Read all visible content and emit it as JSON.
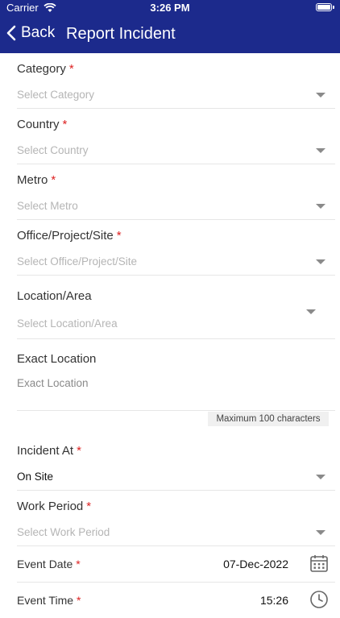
{
  "status": {
    "carrier": "Carrier",
    "time": "3:26 PM"
  },
  "nav": {
    "back_label": "Back",
    "title": "Report Incident"
  },
  "required_marker": "*",
  "fields": {
    "category": {
      "label": "Category",
      "placeholder": "Select Category"
    },
    "country": {
      "label": "Country",
      "placeholder": "Select Country"
    },
    "metro": {
      "label": "Metro",
      "placeholder": "Select Metro"
    },
    "office": {
      "label": "Office/Project/Site",
      "placeholder": "Select Office/Project/Site"
    },
    "location_area": {
      "label": "Location/Area",
      "placeholder": "Select Location/Area"
    },
    "exact_location": {
      "label": "Exact Location",
      "placeholder": "Exact Location",
      "counter": "Maximum 100 characters"
    },
    "incident_at": {
      "label": "Incident At",
      "value": "On Site"
    },
    "work_period": {
      "label": "Work Period",
      "placeholder": "Select Work Period"
    },
    "event_date": {
      "label": "Event Date",
      "value": "07-Dec-2022"
    },
    "event_time": {
      "label": "Event Time",
      "value": "15:26"
    }
  },
  "colors": {
    "header": "#1c2a8c",
    "required": "#dd2222",
    "placeholder": "#b5b5b5"
  }
}
